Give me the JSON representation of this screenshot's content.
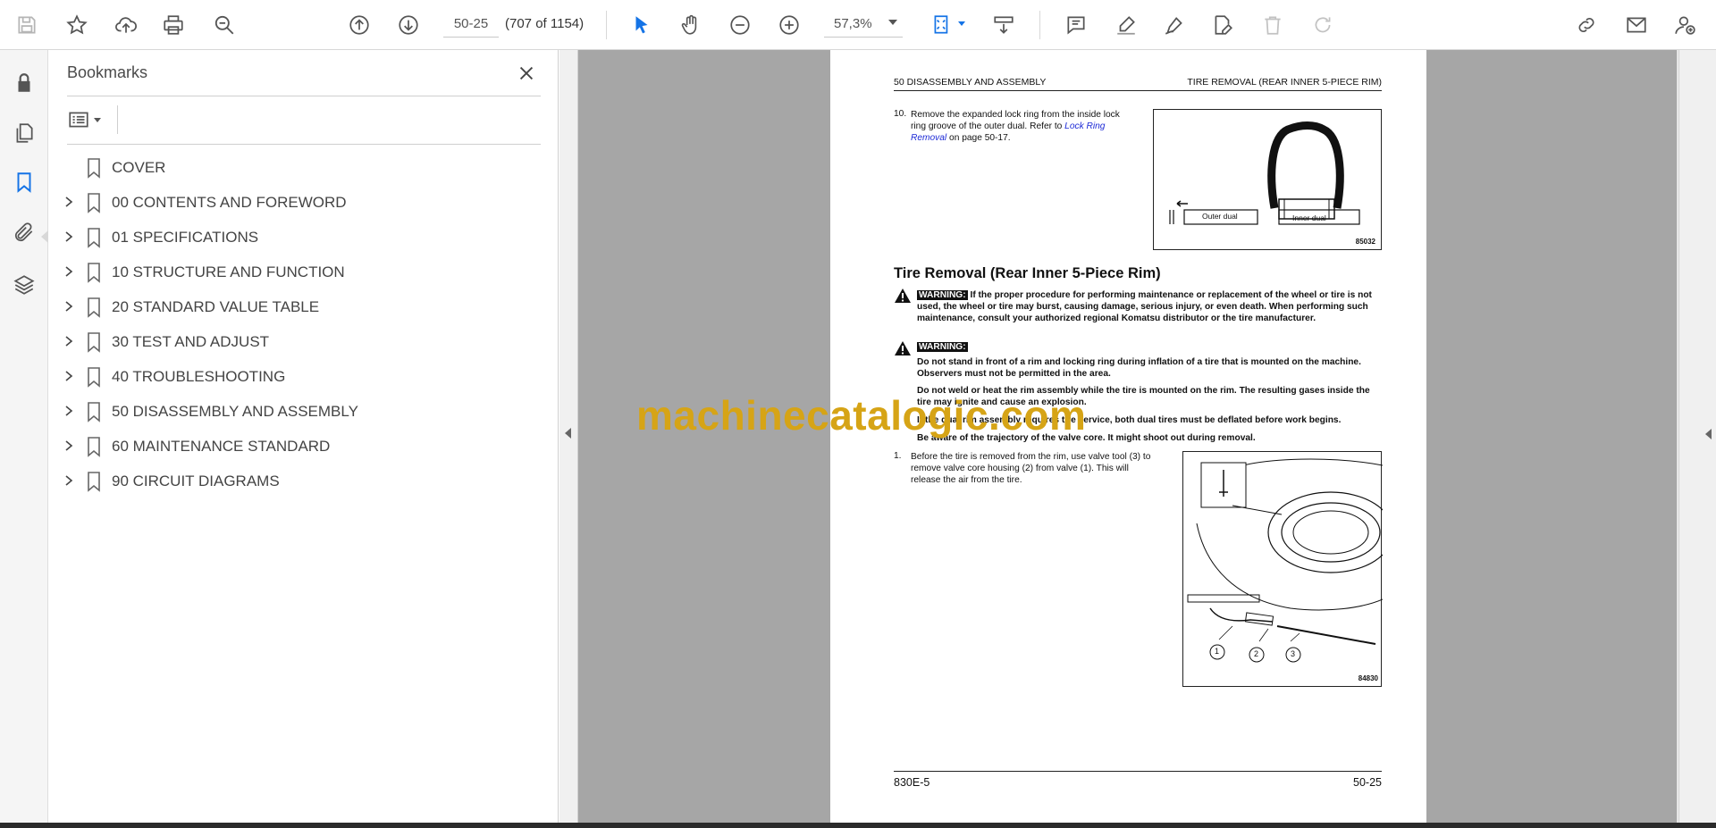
{
  "toolbar": {
    "page_input": "50-25",
    "page_count": "(707 of 1154)",
    "zoom": "57,3%"
  },
  "rail": {
    "icons": [
      "lock-icon",
      "pages-icon",
      "bookmark-icon",
      "attachment-icon",
      "layers-icon"
    ]
  },
  "bookmarks": {
    "title": "Bookmarks",
    "items": [
      {
        "label": "COVER",
        "expandable": false
      },
      {
        "label": "00 CONTENTS AND FOREWORD",
        "expandable": true
      },
      {
        "label": "01 SPECIFICATIONS",
        "expandable": true
      },
      {
        "label": "10 STRUCTURE AND FUNCTION",
        "expandable": true
      },
      {
        "label": "20 STANDARD VALUE TABLE",
        "expandable": true
      },
      {
        "label": "30 TEST AND ADJUST",
        "expandable": true
      },
      {
        "label": "40 TROUBLESHOOTING",
        "expandable": true
      },
      {
        "label": "50 DISASSEMBLY AND ASSEMBLY",
        "expandable": true
      },
      {
        "label": "60 MAINTENANCE STANDARD",
        "expandable": true
      },
      {
        "label": "90 CIRCUIT DIAGRAMS",
        "expandable": true
      }
    ]
  },
  "document": {
    "header_left": "50 DISASSEMBLY AND ASSEMBLY",
    "header_right": "TIRE REMOVAL (REAR INNER 5-PIECE RIM)",
    "step10": {
      "num": "10.",
      "text": "Remove the expanded lock ring from the inside lock ring groove of the outer dual. Refer to",
      "link": "Lock Ring Removal",
      "suffix": "on page 50-17."
    },
    "figure1": {
      "label_outer": "Outer dual",
      "label_inner": "Inner dual",
      "id": "85032"
    },
    "section_title": "Tire Removal (Rear Inner 5-Piece Rim)",
    "warning_badge": "WARNING:",
    "warning1": "If the proper procedure for performing maintenance or replacement of the wheel or tire is not used, the wheel or tire may burst, causing damage, serious injury, or even death. When performing such maintenance, consult your authorized regional Komatsu distributor or the tire manufacturer.",
    "warning2_lines": [
      "Do not stand in front of a rim and locking ring during inflation of a tire that is mounted on the machine. Observers must not be permitted in the area.",
      "Do not weld or heat the rim assembly while the tire is mounted on the rim. The resulting gases inside the tire may ignite and cause an explosion.",
      "If the dual rim assembly requires tire service, both dual tires must be deflated before work begins.",
      "Be aware of the trajectory of the valve core. It might shoot out during removal."
    ],
    "step1": {
      "num": "1.",
      "text": "Before the tire is removed from the rim, use valve tool (3) to remove valve core housing (2) from valve (1). This will release the air from the tire."
    },
    "figure2": {
      "callouts": [
        "1",
        "2",
        "3"
      ],
      "id": "84830"
    },
    "footer_left": "830E-5",
    "footer_right": "50-25"
  },
  "watermark": "machinecatalogic.com",
  "colors": {
    "accent": "#1473e6",
    "watermark": "#d6a416",
    "doc_background": "#a6a6a6",
    "link": "#1d2ad6"
  }
}
